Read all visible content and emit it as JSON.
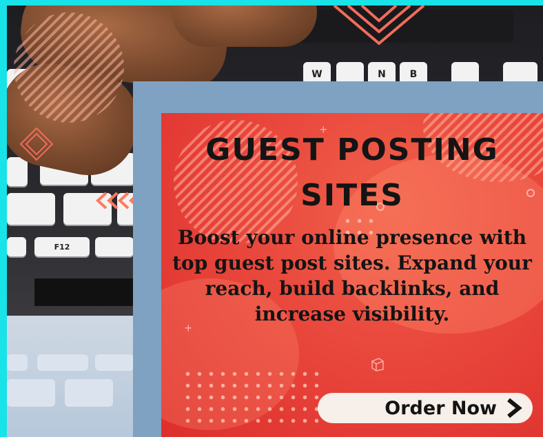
{
  "card": {
    "title_line1": "GUEST POSTING",
    "title_line2": "SITES",
    "body": "Boost your online presence with top guest post sites. Expand your reach, build backlinks, and increase visibility.",
    "button_label": "Order Now"
  },
  "keyboard": {
    "keys": [
      "W",
      "N",
      "B",
      "F12"
    ]
  },
  "colors": {
    "border": "#17e3e8",
    "frame": "#7fa2c2",
    "card_red": "#e9473c",
    "button_bg": "#f7efe9",
    "text": "#141414"
  },
  "icons": [
    "arrow-right-icon"
  ]
}
